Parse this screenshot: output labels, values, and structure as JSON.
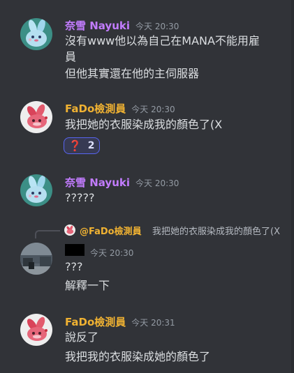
{
  "messages": [
    {
      "author": "奈雪 Nayuki",
      "author_color": "#c27cff",
      "timestamp": "今天 20:30",
      "avatar": "blue-bunny-avatar",
      "lines": [
        "沒有www他以為自己在MANA不能用雇",
        "員",
        "但他其實還在他的主伺服器"
      ]
    },
    {
      "author": "FaDo檢測員",
      "author_color": "#f0b232",
      "timestamp": "今天 20:30",
      "avatar": "red-bunny-avatar",
      "lines": [
        "我把她的衣服染成我的顏色了(X"
      ],
      "reaction": {
        "emoji": "❓",
        "count": "2",
        "icon": "question-mark-icon"
      }
    },
    {
      "author": "奈雪 Nayuki",
      "author_color": "#c27cff",
      "timestamp": "今天 20:30",
      "avatar": "blue-bunny-avatar",
      "lines": [
        "?????"
      ]
    },
    {
      "author": "",
      "author_redacted": true,
      "timestamp": "今天 20:30",
      "avatar": "photo-avatar",
      "reply": {
        "mention": "@FaDo檢測員",
        "text": "我把她的衣服染成我的顏色了(X"
      },
      "lines": [
        "???",
        "解釋一下"
      ]
    },
    {
      "author": "FaDo檢測員",
      "author_color": "#f0b232",
      "timestamp": "今天 20:31",
      "avatar": "red-bunny-avatar",
      "lines": [
        "說反了",
        "我把我的衣服染成她的顏色了"
      ]
    }
  ],
  "colors": {
    "background": "#313338",
    "text": "#dbdee1",
    "timestamp": "#949ba4",
    "reaction_bg": "#373a53",
    "reaction_border": "#5865f2"
  }
}
